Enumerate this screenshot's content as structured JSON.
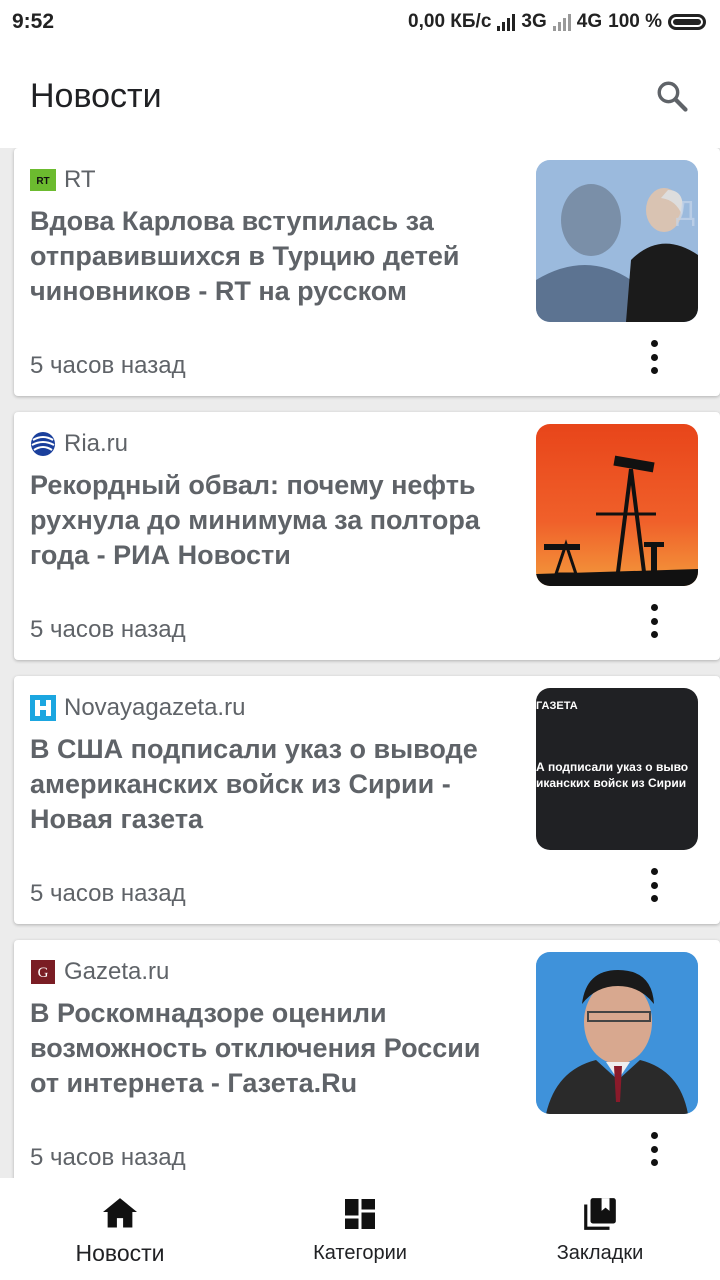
{
  "status_bar": {
    "time": "9:52",
    "speed": "0,00 КБ/с",
    "net1": "3G",
    "net2": "4G",
    "battery": "100 %"
  },
  "app_bar": {
    "title": "Новости",
    "search_icon": "search-icon"
  },
  "articles": [
    {
      "source": "RT",
      "source_icon": "rt-logo",
      "headline": "Вдова Карлова вступилась за отправившихся в Турцию детей чиновников - RT на русском",
      "time": "5 часов назад"
    },
    {
      "source": "Ria.ru",
      "source_icon": "ria-logo",
      "headline": "Рекордный обвал: почему нефть рухнула до минимума за полтора года - РИА Новости",
      "time": "5 часов назад"
    },
    {
      "source": "Novayagazeta.ru",
      "source_icon": "novayagazeta-logo",
      "headline": "В США подписали указ о выводе американских войск из Сирии - Новая газета",
      "time": "5 часов назад",
      "thumb_caption_top": "ГАЗЕТА",
      "thumb_caption_line1": "А подписали указ о выво",
      "thumb_caption_line2": "иканских войск из Сирии"
    },
    {
      "source": "Gazeta.ru",
      "source_icon": "gazeta-logo",
      "headline": "В Роскомнадзоре оценили возможность отключения России от интернета - Газета.Ru",
      "time": "5 часов назад"
    }
  ],
  "bottom_nav": [
    {
      "label": "Новости",
      "icon": "home-icon",
      "active": true
    },
    {
      "label": "Категории",
      "icon": "dashboard-icon",
      "active": false
    },
    {
      "label": "Закладки",
      "icon": "bookmarks-icon",
      "active": false
    }
  ],
  "colors": {
    "accent_text": "#5f6368",
    "rt_green": "#6cbb2f",
    "ria_blue": "#1a3f9c",
    "novaya_blue": "#1ba6e0",
    "gazeta_red": "#7a1d24"
  }
}
